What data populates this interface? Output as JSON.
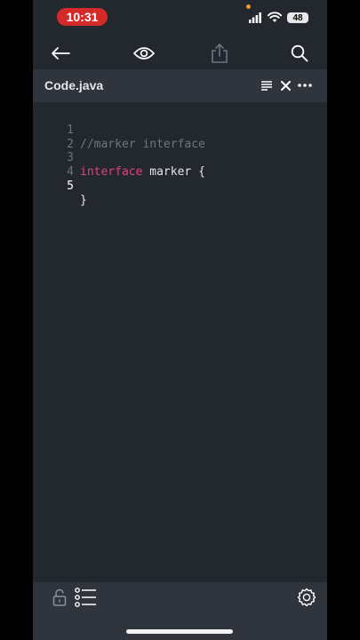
{
  "status_bar": {
    "time": "10:31",
    "battery": "48"
  },
  "toolbar": {
    "icons": [
      "back-arrow-icon",
      "eye-icon",
      "share-icon",
      "search-icon"
    ]
  },
  "tab": {
    "filename": "Code.java"
  },
  "editor": {
    "lines": [
      {
        "number": "1",
        "segments": [
          {
            "type": "comment",
            "text": "//marker interface"
          }
        ]
      },
      {
        "number": "2",
        "segments": []
      },
      {
        "number": "3",
        "segments": [
          {
            "type": "keyword",
            "text": "interface"
          },
          {
            "type": "plain",
            "text": " marker {"
          }
        ]
      },
      {
        "number": "4",
        "segments": []
      },
      {
        "number": "5",
        "segments": [
          {
            "type": "plain",
            "text": "}"
          }
        ]
      }
    ],
    "active_line": "5"
  },
  "bottom_bar": {
    "icons": [
      "lock-icon",
      "outline-list-icon",
      "settings-gear-icon"
    ]
  },
  "colors": {
    "background": "#23272e",
    "bar": "#2f343d",
    "keyword": "#e0437f",
    "comment": "#6f7682",
    "time_pill": "#d52a2a"
  }
}
